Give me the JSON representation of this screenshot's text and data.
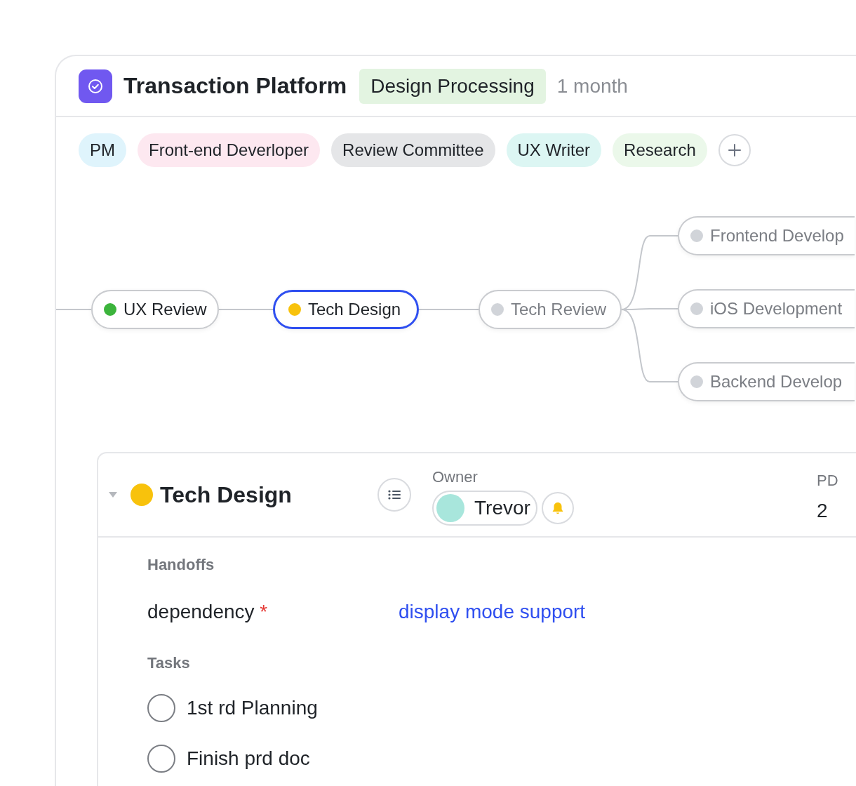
{
  "project": {
    "title": "Transaction Platform",
    "status": "Design Processing",
    "duration": "1 month"
  },
  "roles": [
    {
      "label": "PM",
      "color": "#dff4fc"
    },
    {
      "label": "Front-end Deverloper",
      "color": "#fde8f0"
    },
    {
      "label": "Review Committee",
      "color": "#e5e6e8"
    },
    {
      "label": "UX Writer",
      "color": "#dcf6f3"
    },
    {
      "label": "Research",
      "color": "#ebf8ea"
    }
  ],
  "mindmap": {
    "nodes": [
      {
        "label": "UX Review",
        "color": "#3cb43c",
        "muted": false,
        "selected": false
      },
      {
        "label": "Tech Design",
        "color": "#f8c20c",
        "muted": false,
        "selected": true
      },
      {
        "label": "Tech Review",
        "color": "#d1d4d9",
        "muted": true,
        "selected": false,
        "children": [
          {
            "label": "Frontend Develop",
            "color": "#d1d4d9",
            "muted": true,
            "selected": false
          },
          {
            "label": "iOS Development",
            "color": "#d1d4d9",
            "muted": true,
            "selected": false
          },
          {
            "label": "Backend Develop",
            "color": "#d1d4d9",
            "muted": true,
            "selected": false
          }
        ]
      }
    ]
  },
  "detail": {
    "title": "Tech Design",
    "color": "#f8c20c",
    "expanded": true,
    "owner_label": "Owner",
    "owner": "Trevor",
    "pd_label": "PD",
    "pd": "2",
    "handoffs_label": "Handoffs",
    "dependency_label": "dependency",
    "required_mark": "*",
    "dependency_link": "display mode support",
    "tasks_label": "Tasks",
    "tasks": [
      {
        "label": "1st rd Planning",
        "checked": false
      },
      {
        "label": "Finish prd doc",
        "checked": false
      }
    ]
  }
}
